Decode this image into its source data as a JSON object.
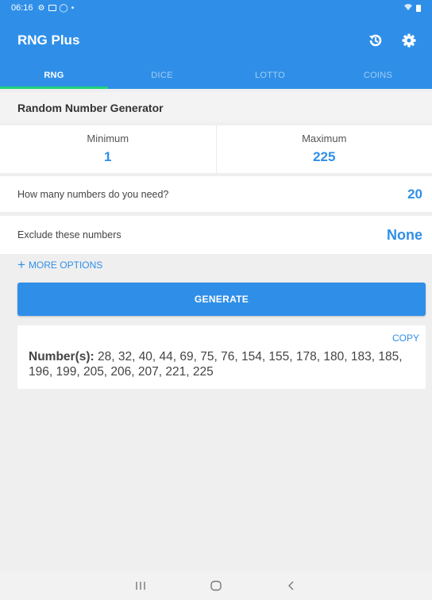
{
  "status_bar": {
    "time": "06:16"
  },
  "app_bar": {
    "title": "RNG Plus"
  },
  "tabs": [
    {
      "label": "RNG",
      "active": true
    },
    {
      "label": "DICE",
      "active": false
    },
    {
      "label": "LOTTO",
      "active": false
    },
    {
      "label": "COINS",
      "active": false
    }
  ],
  "section": {
    "title": "Random Number Generator"
  },
  "range": {
    "min_label": "Minimum",
    "min_value": "1",
    "max_label": "Maximum",
    "max_value": "225"
  },
  "count": {
    "label": "How many numbers do you need?",
    "value": "20"
  },
  "exclude": {
    "label": "Exclude these numbers",
    "value": "None"
  },
  "more_options": {
    "label": "MORE OPTIONS"
  },
  "generate": {
    "label": "GENERATE"
  },
  "result": {
    "copy_label": "COPY",
    "prefix": "Number(s):",
    "numbers": "28, 32, 40, 44, 69, 75, 76, 154, 155, 178, 180, 183, 185, 196, 199, 205, 206, 207, 221, 225"
  },
  "colors": {
    "primary": "#2f8fe8",
    "tab_indicator": "#1fd27a"
  },
  "icons": {
    "history": "history-icon",
    "settings": "gear-icon"
  }
}
